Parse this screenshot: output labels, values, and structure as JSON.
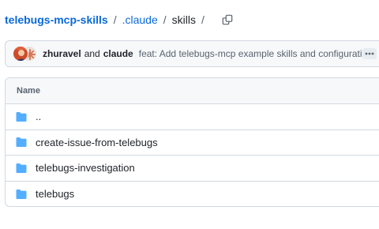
{
  "breadcrumb": {
    "repo": "telebugs-mcp-skills",
    "dir": ".claude",
    "current": "skills",
    "separator": "/"
  },
  "commit": {
    "author1": "zhuravel",
    "conjunction": "and",
    "author2": "claude",
    "message": "feat: Add telebugs-mcp example skills and configuration"
  },
  "table": {
    "header": "Name",
    "rows": [
      {
        "label": "..",
        "icon": "folder-icon"
      },
      {
        "label": "create-issue-from-telebugs",
        "icon": "folder-icon"
      },
      {
        "label": "telebugs-investigation",
        "icon": "folder-icon"
      },
      {
        "label": "telebugs",
        "icon": "folder-icon"
      }
    ]
  },
  "colors": {
    "link": "#0969da",
    "folder": "#54aeff",
    "muted": "#59636e",
    "border": "#d1d9e0"
  }
}
